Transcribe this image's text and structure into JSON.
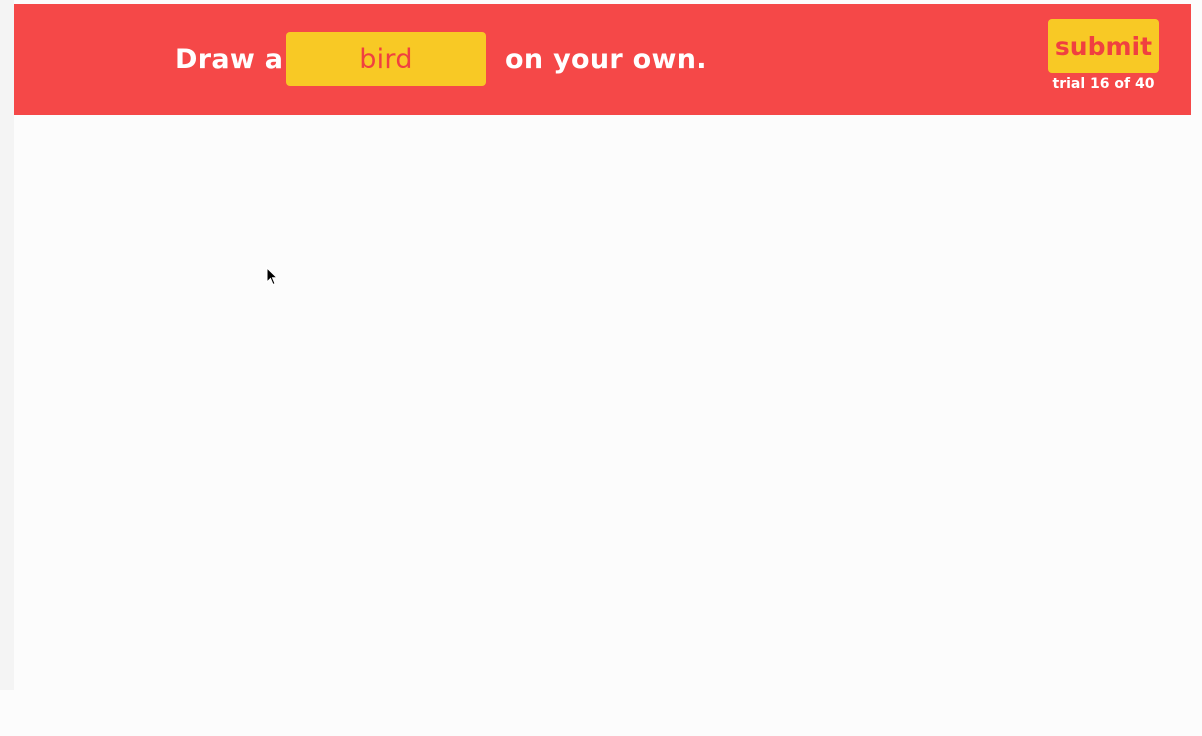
{
  "header": {
    "prompt_prefix": "Draw a",
    "category": "bird",
    "prompt_suffix": "on your own.",
    "submit_label": "submit",
    "trial_text": "trial 16 of 40"
  },
  "colors": {
    "header_bg": "#f54848",
    "accent_yellow": "#f8c925",
    "accent_red_text": "#f04040",
    "canvas_bg": "#fcfcfc"
  },
  "icons": {
    "cursor": "mouse-pointer-icon"
  }
}
